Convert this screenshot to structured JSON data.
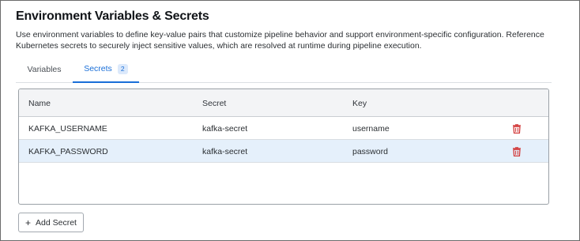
{
  "header": {
    "title": "Environment Variables & Secrets",
    "description": "Use environment variables to define key-value pairs that customize pipeline behavior and support environment-specific configuration. Reference Kubernetes secrets to securely inject sensitive values, which are resolved at runtime during pipeline execution."
  },
  "tabs": [
    {
      "label": "Variables"
    },
    {
      "label": "Secrets",
      "badge": "2",
      "active": true
    }
  ],
  "table": {
    "columns": [
      "Name",
      "Secret",
      "Key"
    ],
    "rows": [
      {
        "name": "KAFKA_USERNAME",
        "secret": "kafka-secret",
        "key": "username",
        "action_icon": "trash-icon"
      },
      {
        "name": "KAFKA_PASSWORD",
        "secret": "kafka-secret",
        "key": "password",
        "action_icon": "trash-icon",
        "highlighted": true
      }
    ]
  },
  "actions": {
    "add_label": "Add Secret",
    "add_icon": "plus-icon"
  },
  "colors": {
    "accent": "#1a6fd8",
    "delete": "#d23a3a",
    "row_highlight": "#e5f0fb"
  }
}
